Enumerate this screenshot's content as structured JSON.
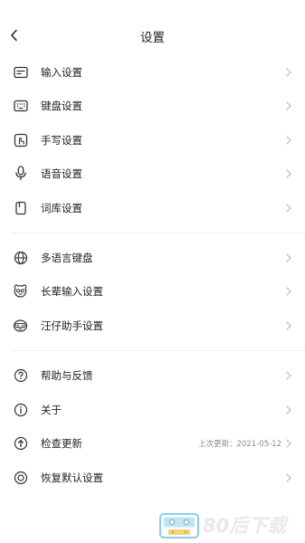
{
  "header": {
    "title": "设置"
  },
  "sections": [
    {
      "items": [
        {
          "label": "输入设置",
          "icon": "input-settings-icon"
        },
        {
          "label": "键盘设置",
          "icon": "keyboard-icon"
        },
        {
          "label": "手写设置",
          "icon": "handwriting-icon"
        },
        {
          "label": "语音设置",
          "icon": "microphone-icon"
        },
        {
          "label": "词库设置",
          "icon": "dictionary-icon"
        }
      ]
    },
    {
      "items": [
        {
          "label": "多语言键盘",
          "icon": "globe-icon"
        },
        {
          "label": "长辈输入设置",
          "icon": "elder-face-icon"
        },
        {
          "label": "汪仔助手设置",
          "icon": "dog-assistant-icon"
        }
      ]
    },
    {
      "items": [
        {
          "label": "帮助与反馈",
          "icon": "help-icon"
        },
        {
          "label": "关于",
          "icon": "info-icon"
        },
        {
          "label": "检查更新",
          "icon": "update-icon",
          "meta": "上次更新：2021-05-12"
        },
        {
          "label": "恢复默认设置",
          "icon": "reset-icon"
        }
      ]
    }
  ],
  "watermark": {
    "text": "80后下载",
    "icon": "cassette-logo-icon"
  },
  "colors": {
    "text": "#222222",
    "meta": "#8a8a8a",
    "chevron": "#b5b5b5",
    "divider": "#ececec",
    "watermark": "#e9e9e9"
  }
}
